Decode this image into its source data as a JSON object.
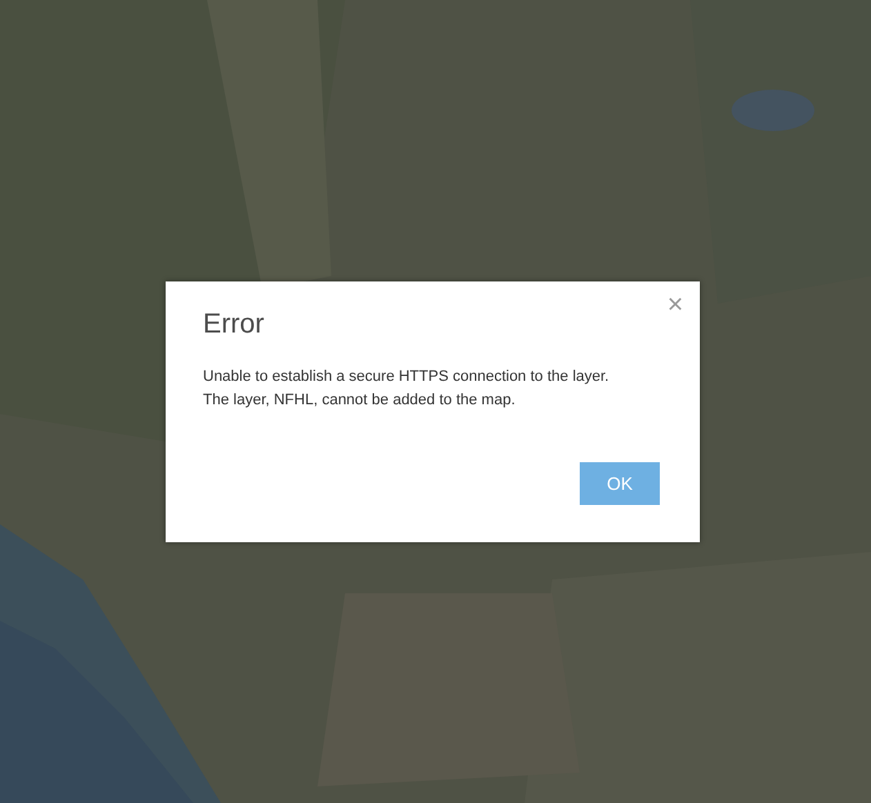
{
  "dialog": {
    "title": "Error",
    "close": "×",
    "message": [
      "Unable to establish a secure HTTPS connection to the layer.",
      "The layer, NFHL, cannot be added to the map."
    ],
    "buttons": [
      "OK"
    ]
  }
}
